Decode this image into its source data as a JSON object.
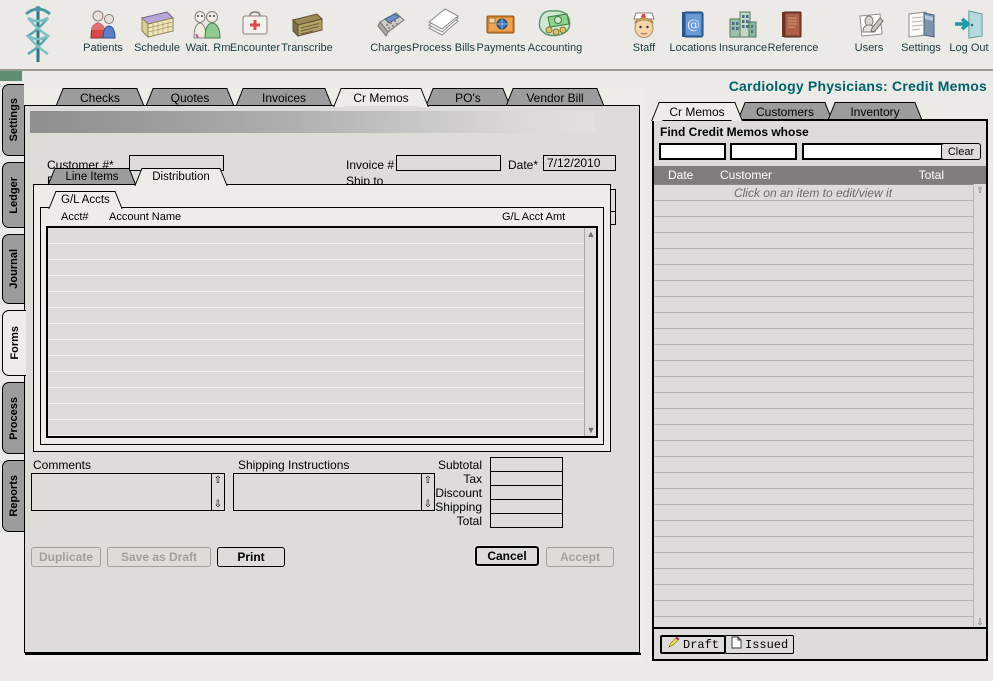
{
  "app": {
    "logo_icon": "caduceus-icon"
  },
  "toolbar": {
    "groups": [
      {
        "items": [
          {
            "label": "Patients",
            "icon": "patients-icon"
          },
          {
            "label": "Schedule",
            "icon": "calendar-icon"
          },
          {
            "label": "Wait. Rm",
            "icon": "waiting-room-icon"
          },
          {
            "label": "Encounter",
            "icon": "medical-bag-icon"
          },
          {
            "label": "Transcribe",
            "icon": "transcribe-icon"
          }
        ]
      },
      {
        "items": [
          {
            "label": "Charges",
            "icon": "calculator-icon"
          },
          {
            "label": "Process Bills",
            "icon": "papers-stack-icon"
          },
          {
            "label": "Payments",
            "icon": "payment-card-icon"
          },
          {
            "label": "Accounting",
            "icon": "money-icon"
          }
        ]
      },
      {
        "items": [
          {
            "label": "Staff",
            "icon": "nurse-icon"
          },
          {
            "label": "Locations",
            "icon": "address-book-icon"
          },
          {
            "label": "Insurance",
            "icon": "buildings-icon"
          },
          {
            "label": "Reference",
            "icon": "book-icon"
          }
        ]
      },
      {
        "items": [
          {
            "label": "Users",
            "icon": "user-pen-icon"
          },
          {
            "label": "Settings",
            "icon": "settings-icon"
          },
          {
            "label": "Log Out",
            "icon": "exit-door-icon"
          }
        ]
      }
    ]
  },
  "sidebar": {
    "tabs": [
      {
        "label": "Settings",
        "active": false
      },
      {
        "label": "Ledger",
        "active": false
      },
      {
        "label": "Journal",
        "active": false
      },
      {
        "label": "Forms",
        "active": true
      },
      {
        "label": "Process",
        "active": false
      },
      {
        "label": "Reports",
        "active": false
      }
    ]
  },
  "page": {
    "title": "Cardiology Physicians:  Credit Memos",
    "title_color": "#00626b"
  },
  "main_tabs": [
    {
      "label": "Checks",
      "active": false
    },
    {
      "label": "Quotes",
      "active": false
    },
    {
      "label": "Invoices",
      "active": false
    },
    {
      "label": "Cr Memos",
      "active": true
    },
    {
      "label": "PO's",
      "active": false
    },
    {
      "label": "Vendor Bill",
      "active": false
    }
  ],
  "form": {
    "customer_label": "Customer #*",
    "customer_value": "",
    "invoice_label": "Invoice #",
    "invoice_value": "",
    "date_label": "Date*",
    "date_value": "7/12/2010",
    "bill_to_label": "Bill to*",
    "ship_to_label": "Ship to",
    "inner_tabs": [
      {
        "label": "Line Items",
        "active": false
      },
      {
        "label": "Distribution",
        "active": true
      }
    ],
    "gl_tab_label": "G/L Accts",
    "gl_columns": {
      "acct": "Acct#",
      "account_name": "Account Name",
      "amount": "G/L Acct Amt"
    },
    "gl_rows": [],
    "comments_label": "Comments",
    "comments_value": "",
    "shipping_instructions_label": "Shipping Instructions",
    "shipping_instructions_value": "",
    "totals": [
      {
        "label": "Subtotal",
        "value": ""
      },
      {
        "label": "Tax",
        "value": ""
      },
      {
        "label": "Discount",
        "value": ""
      },
      {
        "label": "Shipping",
        "value": ""
      },
      {
        "label": "Total",
        "value": ""
      }
    ],
    "buttons": {
      "duplicate": "Duplicate",
      "save_as_draft": "Save as Draft",
      "print": "Print",
      "cancel": "Cancel",
      "accept": "Accept"
    }
  },
  "right_panel": {
    "tabs": [
      {
        "label": "Cr Memos",
        "active": true
      },
      {
        "label": "Customers",
        "active": false
      },
      {
        "label": "Inventory",
        "active": false
      }
    ],
    "find_title": "Find Credit Memos whose",
    "search_fields": [
      "",
      "",
      ""
    ],
    "clear_label": "Clear",
    "columns": {
      "date": "Date",
      "customer": "Customer",
      "total": "Total"
    },
    "hint": "Click on an item to edit/view it",
    "rows": [],
    "footer_buttons": [
      {
        "label": "Draft",
        "icon": "pencil-icon",
        "emphasis": true
      },
      {
        "label": "Issued",
        "icon": "document-icon",
        "emphasis": false
      }
    ]
  }
}
